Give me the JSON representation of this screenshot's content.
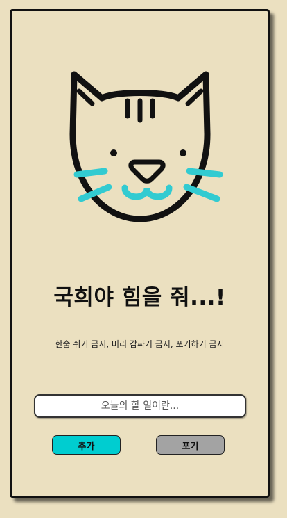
{
  "header": {
    "title": "국희야 힘을 줘...!",
    "subtitle": "한숨 쉬기 금지, 머리 감싸기 금지, 포기하기 금지"
  },
  "todo": {
    "placeholder": "오늘의 할 일이란..."
  },
  "buttons": {
    "add_label": "추가",
    "giveup_label": "포기"
  },
  "colors": {
    "background": "#ebe0c0",
    "accent_cyan": "#32cbd1",
    "add_button": "#00cdd0",
    "giveup_button": "#a3a3a3",
    "outline": "#111111"
  },
  "icons": {
    "mascot": "cat-face-icon"
  }
}
